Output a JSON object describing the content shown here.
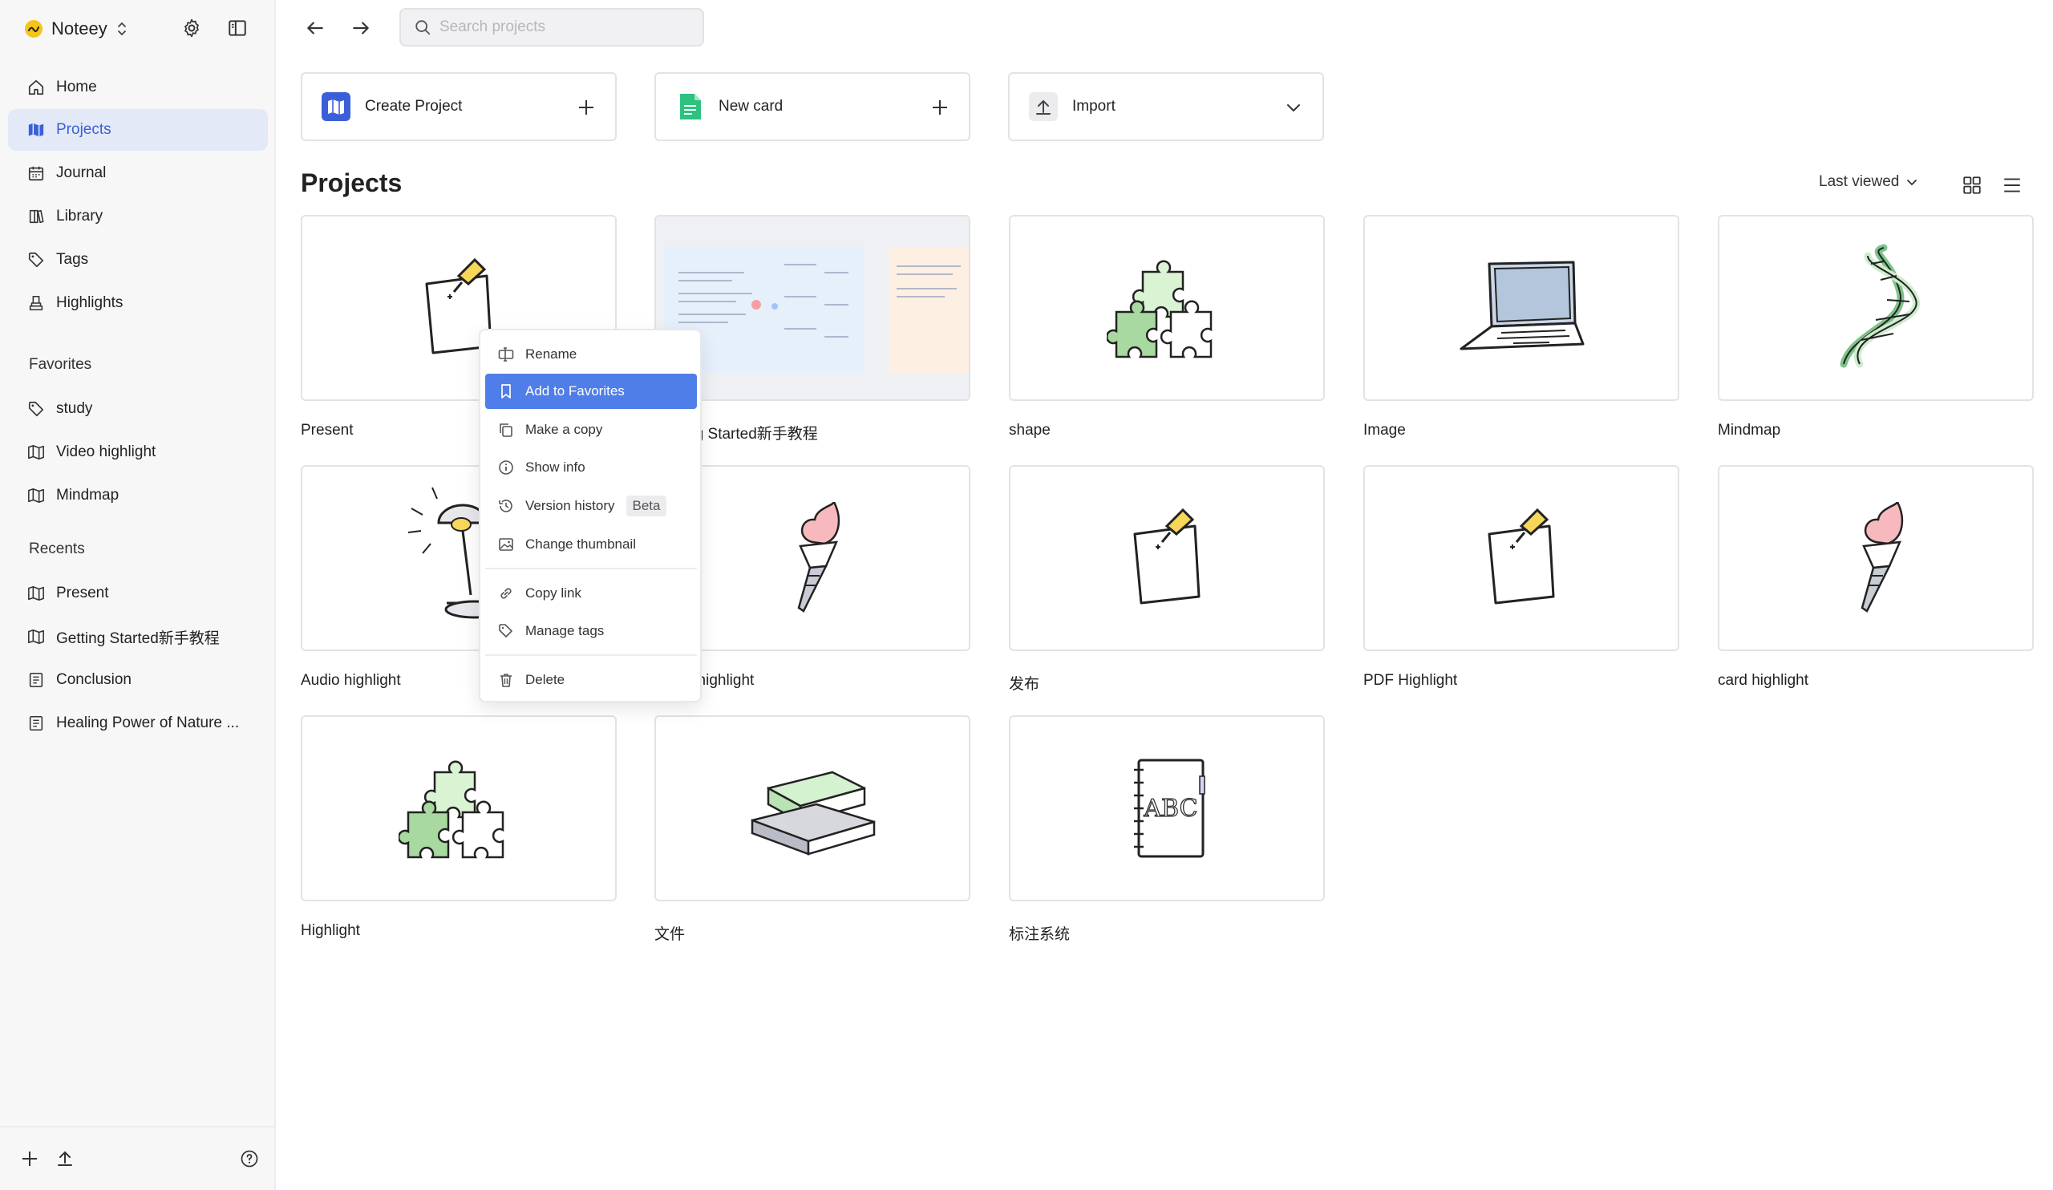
{
  "app": {
    "name": "Noteey"
  },
  "sidebar": {
    "nav": [
      {
        "label": "Home",
        "icon": "home-icon"
      },
      {
        "label": "Projects",
        "icon": "map-icon",
        "active": true
      },
      {
        "label": "Journal",
        "icon": "calendar-icon"
      },
      {
        "label": "Library",
        "icon": "book-icon"
      },
      {
        "label": "Tags",
        "icon": "tag-icon"
      },
      {
        "label": "Highlights",
        "icon": "highlighter-icon"
      }
    ],
    "favorites_label": "Favorites",
    "favorites": [
      {
        "label": "study",
        "icon": "tag-icon"
      },
      {
        "label": "Video highlight",
        "icon": "map-icon"
      },
      {
        "label": "Mindmap",
        "icon": "map-icon"
      }
    ],
    "recents_label": "Recents",
    "recents": [
      {
        "label": "Present",
        "icon": "map-icon"
      },
      {
        "label": "Getting Started新手教程",
        "icon": "map-icon"
      },
      {
        "label": "Conclusion",
        "icon": "document-icon"
      },
      {
        "label": "Healing Power of Nature ...",
        "icon": "document-icon"
      }
    ]
  },
  "search": {
    "placeholder": "Search projects"
  },
  "actions": {
    "create_project": "Create Project",
    "new_card": "New card",
    "import": "Import"
  },
  "projects": {
    "title": "Projects",
    "sort_label": "Last viewed",
    "items": [
      {
        "title": "Present",
        "thumb": "pin-note"
      },
      {
        "title": "Getting Started新手教程",
        "thumb": "screenshot"
      },
      {
        "title": "shape",
        "thumb": "puzzle"
      },
      {
        "title": "Image",
        "thumb": "laptop"
      },
      {
        "title": "Mindmap",
        "thumb": "dna"
      },
      {
        "title": "Audio highlight",
        "thumb": "lamp"
      },
      {
        "title": "Video highlight",
        "thumb": "torch"
      },
      {
        "title": "发布",
        "thumb": "pin-note"
      },
      {
        "title": "PDF Highlight",
        "thumb": "pin-note"
      },
      {
        "title": "card highlight",
        "thumb": "torch"
      },
      {
        "title": "Highlight",
        "thumb": "puzzle"
      },
      {
        "title": "文件",
        "thumb": "books"
      },
      {
        "title": "标注系统",
        "thumb": "notebook"
      }
    ]
  },
  "context_menu": {
    "rename": "Rename",
    "add_to_favorites": "Add to Favorites",
    "make_copy": "Make a copy",
    "show_info": "Show info",
    "version_history": "Version history",
    "beta": "Beta",
    "change_thumbnail": "Change thumbnail",
    "copy_link": "Copy link",
    "manage_tags": "Manage tags",
    "delete": "Delete"
  },
  "colors": {
    "accent": "#3b5fd9",
    "active_bg": "#e4e9f7",
    "menu_highlight": "#4f7ee8",
    "brand_yellow": "#f5c518"
  }
}
